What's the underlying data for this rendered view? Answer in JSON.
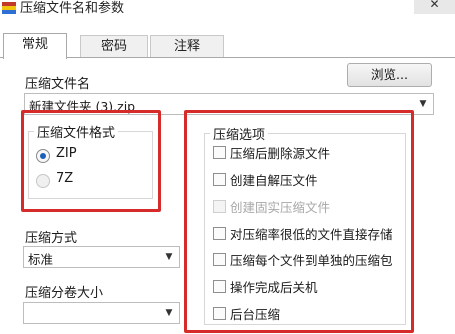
{
  "window": {
    "title": "压缩文件名和参数",
    "close_glyph": "✕"
  },
  "tabs": [
    {
      "label": "常规",
      "active": true
    },
    {
      "label": "密码",
      "active": false
    },
    {
      "label": "注释",
      "active": false
    }
  ],
  "archive": {
    "label": "压缩文件名",
    "value": "新建文件夹 (3).zip",
    "browse_label": "浏览..."
  },
  "format": {
    "title": "压缩文件格式",
    "options": [
      {
        "label": "ZIP",
        "checked": true,
        "enabled": true
      },
      {
        "label": "7Z",
        "checked": false,
        "enabled": false
      }
    ]
  },
  "options": {
    "title": "压缩选项",
    "items": [
      {
        "label": "压缩后删除源文件",
        "checked": false,
        "enabled": true
      },
      {
        "label": "创建自解压文件",
        "checked": false,
        "enabled": true
      },
      {
        "label": "创建固实压缩文件",
        "checked": false,
        "enabled": false
      },
      {
        "label": "对压缩率很低的文件直接存储",
        "checked": false,
        "enabled": true
      },
      {
        "label": "压缩每个文件到单独的压缩包",
        "checked": false,
        "enabled": true
      },
      {
        "label": "操作完成后关机",
        "checked": false,
        "enabled": true
      },
      {
        "label": "后台压缩",
        "checked": false,
        "enabled": true
      }
    ]
  },
  "method": {
    "label": "压缩方式",
    "value": "标准"
  },
  "split": {
    "label": "压缩分卷大小",
    "value": ""
  },
  "accent_colors": {
    "highlight": "#d62b2b",
    "selected_radio": "#1d5fb8"
  }
}
